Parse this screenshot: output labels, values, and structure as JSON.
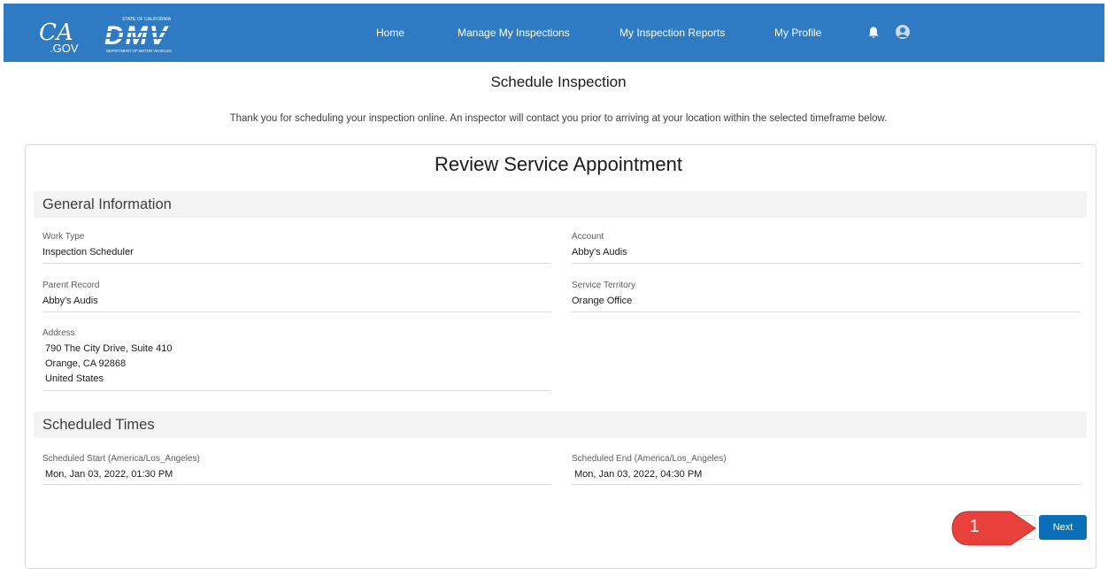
{
  "header": {
    "ca_logo": "CA",
    "ca_logo_suffix": ".GOV",
    "dmv_logo_state": "STATE OF CALIFORNIA",
    "dmv_logo": "DMV",
    "dmv_logo_dept": "DEPARTMENT OF MOTOR VEHICLES",
    "nav": {
      "home": "Home",
      "manage": "Manage My Inspections",
      "reports": "My Inspection Reports",
      "profile": "My Profile"
    },
    "icons": {
      "notifications": "bell-icon",
      "user": "avatar-icon"
    },
    "bar_color": "#2e7bc4"
  },
  "page": {
    "title": "Schedule Inspection",
    "intro": "Thank you for scheduling your inspection online. An inspector will contact you prior to arriving at your location within the selected timeframe below."
  },
  "card": {
    "title": "Review Service Appointment",
    "general": {
      "heading": "General Information",
      "work_type": {
        "label": "Work Type",
        "value": "Inspection Scheduler"
      },
      "account": {
        "label": "Account",
        "value": "Abby's Audis"
      },
      "parent_record": {
        "label": "Parent Record",
        "value": "Abby's Audis"
      },
      "service_territory": {
        "label": "Service Territory",
        "value": "Orange Office"
      },
      "address": {
        "label": "Address",
        "line1": "790 The City Drive, Suite 410",
        "line2": "Orange, CA 92868",
        "line3": "United States"
      }
    },
    "times": {
      "heading": "Scheduled Times",
      "start": {
        "label": "Scheduled Start (America/Los_Angeles)",
        "value": "Mon, Jan 03, 2022, 01:30 PM"
      },
      "end": {
        "label": "Scheduled End (America/Los_Angeles)",
        "value": "Mon, Jan 03, 2022, 04:30 PM"
      }
    },
    "next_label": "Next",
    "button_color": "#0b6fb8"
  },
  "annotation": {
    "step": "1",
    "color": "#e8403a"
  }
}
